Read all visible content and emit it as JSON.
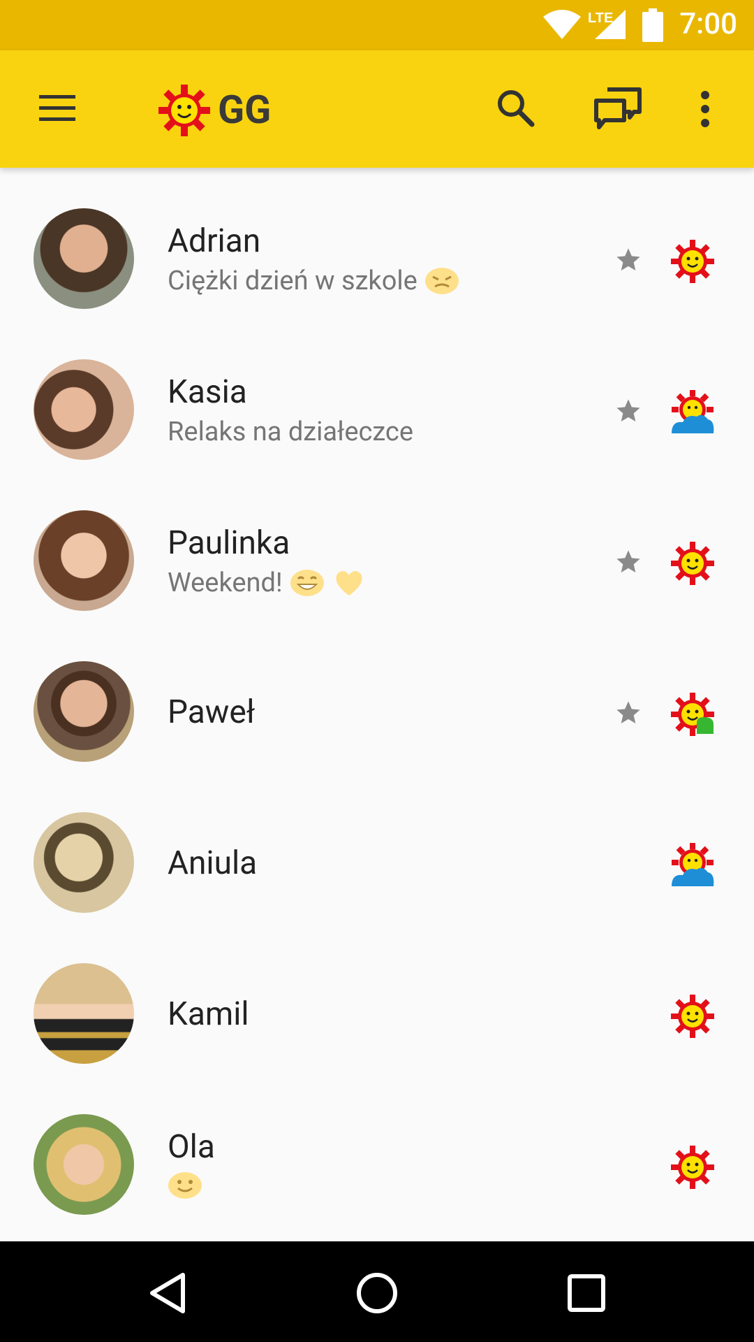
{
  "statusbar": {
    "network": "LTE",
    "time": "7:00"
  },
  "appbar": {
    "title": "GG"
  },
  "contacts": [
    {
      "name": "Adrian",
      "status": "Ciężki dzień w szkole",
      "status_emoji": "angry-emoji",
      "favorite": true,
      "presence": "online"
    },
    {
      "name": "Kasia",
      "status": "Relaks na działeczce",
      "favorite": true,
      "presence": "away"
    },
    {
      "name": "Paulinka",
      "status": "Weekend!",
      "status_emoji": "grin-emoji heart-emoji",
      "favorite": true,
      "presence": "online"
    },
    {
      "name": "Paweł",
      "status": "",
      "favorite": true,
      "presence": "online-chat"
    },
    {
      "name": "Aniula",
      "status": "",
      "favorite": false,
      "presence": "away"
    },
    {
      "name": "Kamil",
      "status": "",
      "favorite": false,
      "presence": "online"
    },
    {
      "name": "Ola",
      "status": "",
      "status_emoji": "smile-emoji",
      "favorite": false,
      "presence": "online"
    }
  ],
  "colors": {
    "appbar": "#f9d30f",
    "statusbar": "#e9b700",
    "gg_red": "#e3101a",
    "gg_yellow": "#ffe100"
  }
}
